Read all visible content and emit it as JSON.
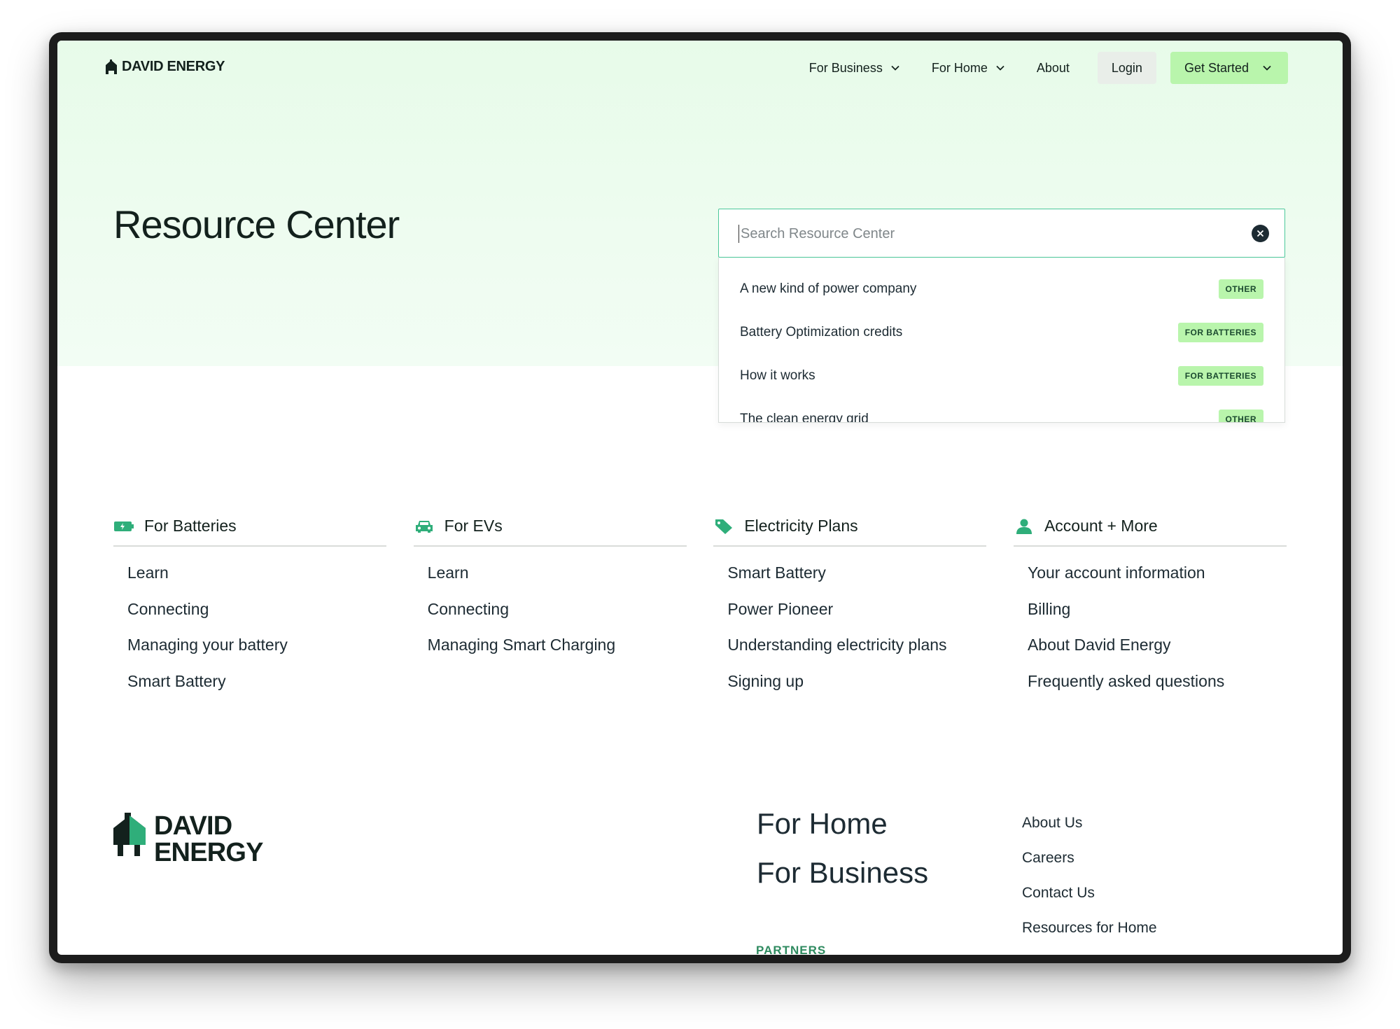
{
  "brand": {
    "name": "DAVID ENERGY",
    "footer_line1": "DAVID",
    "footer_line2": "ENERGY"
  },
  "nav": {
    "for_business": "For Business",
    "for_home": "For Home",
    "about": "About",
    "login": "Login",
    "get_started": "Get Started"
  },
  "hero": {
    "title": "Resource Center"
  },
  "search": {
    "placeholder": "Search Resource Center",
    "results": [
      {
        "title": "A new kind of power company",
        "tag": "OTHER"
      },
      {
        "title": "Battery Optimization credits",
        "tag": "FOR BATTERIES"
      },
      {
        "title": "How it works",
        "tag": "FOR BATTERIES"
      },
      {
        "title": "The clean energy grid",
        "tag": "OTHER"
      }
    ]
  },
  "columns": [
    {
      "title": "For Batteries",
      "icon": "battery-icon",
      "links": [
        "Learn",
        "Connecting",
        "Managing your battery",
        "Smart Battery"
      ]
    },
    {
      "title": "For EVs",
      "icon": "car-icon",
      "links": [
        "Learn",
        "Connecting",
        "Managing Smart Charging"
      ]
    },
    {
      "title": "Electricity Plans",
      "icon": "tag-icon",
      "links": [
        "Smart Battery",
        "Power Pioneer",
        "Understanding electricity plans",
        "Signing up"
      ]
    },
    {
      "title": "Account + More",
      "icon": "user-icon",
      "links": [
        "Your account information",
        "Billing",
        "About David Energy",
        "Frequently asked questions"
      ]
    }
  ],
  "footer": {
    "for_home": "For Home",
    "for_business": "For Business",
    "partners": "PARTNERS",
    "links": [
      "About Us",
      "Careers",
      "Contact Us",
      "Resources for Home"
    ]
  },
  "colors": {
    "accent_green": "#b9f5ac",
    "icon_green": "#2fae7a",
    "dark": "#13211d"
  }
}
